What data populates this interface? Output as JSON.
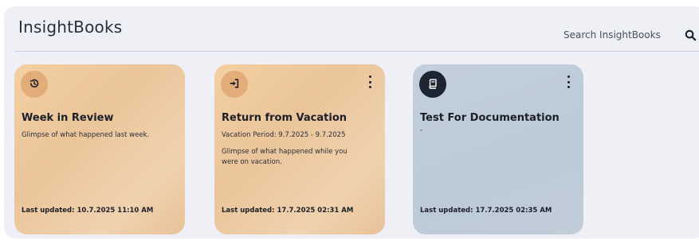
{
  "app": {
    "title": "InsightBooks"
  },
  "search": {
    "placeholder": "Search InsightBooks",
    "icon": "search-icon"
  },
  "colors": {
    "tan_card": "#efcca3",
    "gray_card": "#c0ccda",
    "panel": "#eef0f6"
  },
  "cards": [
    {
      "title": "Week in Review",
      "line1": "Glimpse of what happened last week.",
      "line2": "",
      "footer": "Last updated: 10.7.2025 11:10 AM",
      "icon": "history-icon",
      "has_menu": false
    },
    {
      "title": "Return from Vacation",
      "line1": "Vacation Period: 9.7.2025 - 9.7.2025",
      "line2": "Glimpse of what happened while you were on vacation.",
      "footer": "Last updated: 17.7.2025 02:31 AM",
      "icon": "sign-in-icon",
      "has_menu": true
    },
    {
      "title": "Test For Documentation",
      "line1": "-",
      "line2": "",
      "footer": "Last updated: 17.7.2025 02:35 AM",
      "icon": "book-icon",
      "has_menu": true
    }
  ]
}
